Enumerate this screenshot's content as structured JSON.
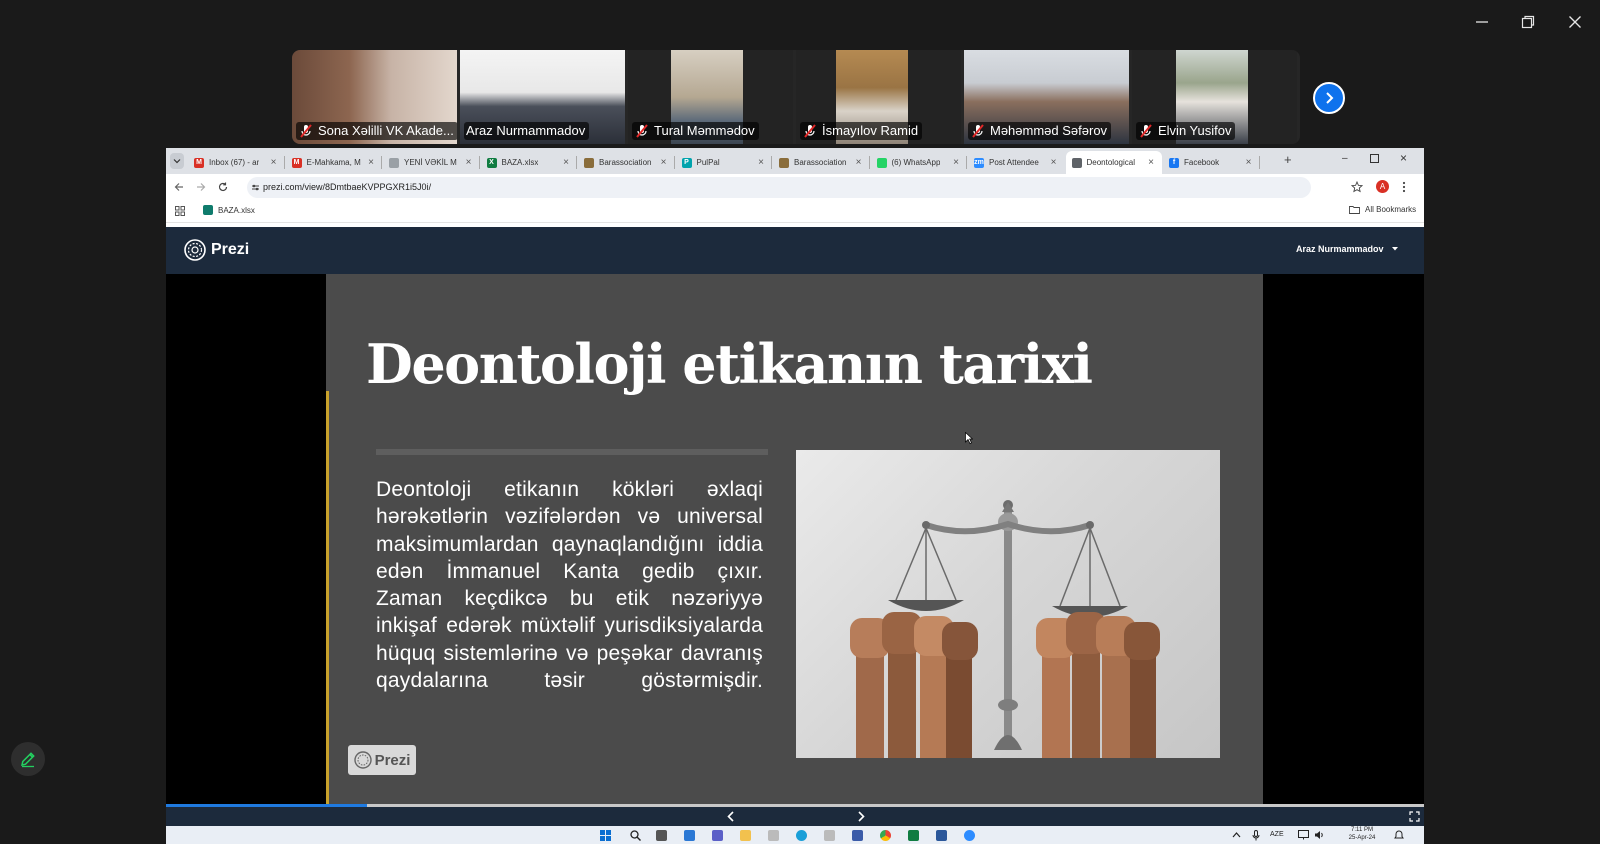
{
  "participants": [
    {
      "name": "Sona Xəlilli VK Akade...",
      "muted": true,
      "active": false
    },
    {
      "name": "Araz Nurmammadov",
      "muted": false,
      "active": true
    },
    {
      "name": "Tural Məmmədov",
      "muted": true,
      "active": false
    },
    {
      "name": "İsmayılov Ramid",
      "muted": true,
      "active": false
    },
    {
      "name": "Məhəmməd Səfərov",
      "muted": true,
      "active": false
    },
    {
      "name": "Elvin Yusifov",
      "muted": true,
      "active": false
    }
  ],
  "browser": {
    "tabs": [
      {
        "label": "Inbox (67) - ar",
        "icon": "gmail-icon",
        "color": "#d93025",
        "glyph": "M"
      },
      {
        "label": "E-Mahkama, M",
        "icon": "gmail-icon",
        "color": "#d93025",
        "glyph": "M"
      },
      {
        "label": "YENİ VƏKİL M",
        "icon": "document-icon",
        "color": "#9aa0a6",
        "glyph": ""
      },
      {
        "label": "BAZA.xlsx",
        "icon": "excel-icon",
        "color": "#107c41",
        "glyph": "X"
      },
      {
        "label": "Barassociation",
        "icon": "bar-association-icon",
        "color": "#8a6d3b",
        "glyph": ""
      },
      {
        "label": "PulPal",
        "icon": "pulpal-icon",
        "color": "#00a3ad",
        "glyph": "P"
      },
      {
        "label": "Barassociation",
        "icon": "bar-association-icon",
        "color": "#8a6d3b",
        "glyph": ""
      },
      {
        "label": "(6) WhatsApp",
        "icon": "whatsapp-icon",
        "color": "#25d366",
        "glyph": ""
      },
      {
        "label": "Post Attendee",
        "icon": "zoom-icon",
        "color": "#2d8cff",
        "glyph": "zm"
      },
      {
        "label": "Deontological",
        "icon": "globe-icon",
        "color": "#5f6368",
        "glyph": ""
      },
      {
        "label": "Facebook",
        "icon": "facebook-icon",
        "color": "#1877f2",
        "glyph": "f"
      }
    ],
    "active_tab": 9,
    "url": "prezi.com/view/8DmtbaeKVPPGXR1i5J0i/",
    "bookmarks": [
      {
        "label": "BAZA.xlsx"
      }
    ],
    "all_bookmarks_label": "All Bookmarks",
    "profile_initial": "A"
  },
  "prezi": {
    "logo_label": "Prezi",
    "user_name": "Araz Nurmammadov",
    "badge_label": "Prezi",
    "progress": 0.16,
    "slide": {
      "title": "Deontoloji etikanın tarixi",
      "body": "Deontoloji etikanın kökləri əxlaqi hərəkətlərin vəzifələrdən və universal maksimumlardan qaynaqlandığını iddia edən İmmanuel Kanta gedib çıxır. Zaman keçdikcə bu etik nəzəriyyə inkişaf edərək müxtəlif yurisdiksiyalarda hüquq sistemlərinə və peşəkar davranış qaydalarına təsir göstərmişdir."
    }
  },
  "taskbar": {
    "language": "AZE",
    "time": "7:11 PM",
    "date": "25-Apr-24"
  },
  "colors": {
    "zoom_blue": "#0e72ed",
    "active_speaker": "#23d160",
    "prezi_navy": "#1c2a3c",
    "slide_gray": "#4b4b4b",
    "accent_gold": "#c8a12b"
  }
}
